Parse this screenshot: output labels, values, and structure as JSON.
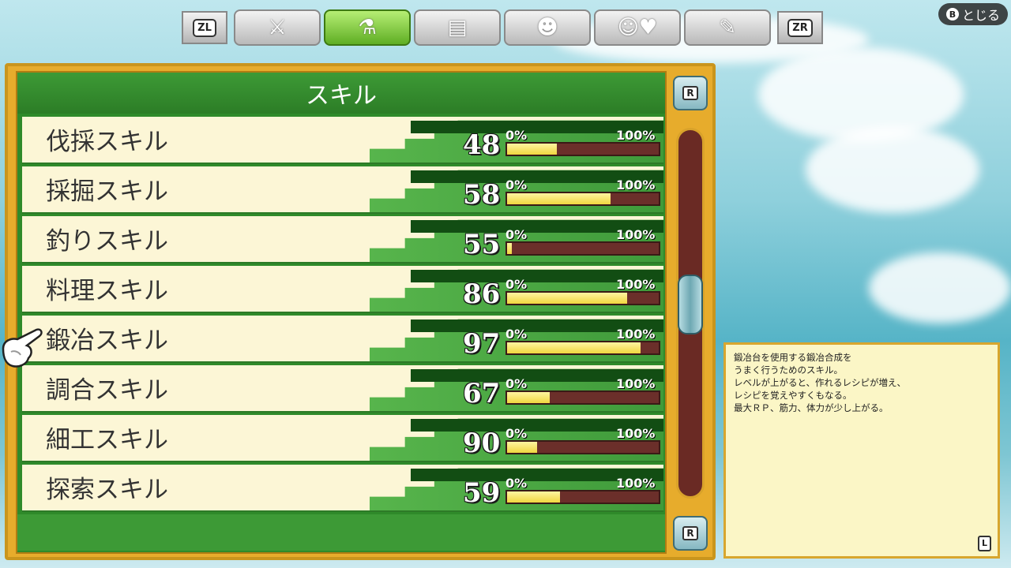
{
  "tabs": {
    "left_shoulder": "ZL",
    "right_shoulder": "ZR",
    "items": [
      {
        "icon": "sword-shield-icon",
        "glyph": "⚔"
      },
      {
        "icon": "potion-hammer-icon",
        "glyph": "⚗"
      },
      {
        "icon": "document-icon",
        "glyph": "▤"
      },
      {
        "icon": "monster-faces-icon",
        "glyph": "☻"
      },
      {
        "icon": "smile-heart-icon",
        "glyph": "☺♥"
      },
      {
        "icon": "wrench-icon",
        "glyph": "✎"
      }
    ],
    "active_index": 1
  },
  "close": {
    "button": "B",
    "label": "とじる"
  },
  "panel": {
    "title": "スキル"
  },
  "skills": [
    {
      "name": "伐採スキル",
      "level": "48",
      "min": "0%",
      "max": "100%",
      "progress": 0.33
    },
    {
      "name": "採掘スキル",
      "level": "58",
      "min": "0%",
      "max": "100%",
      "progress": 0.68
    },
    {
      "name": "釣りスキル",
      "level": "55",
      "min": "0%",
      "max": "100%",
      "progress": 0.03
    },
    {
      "name": "料理スキル",
      "level": "86",
      "min": "0%",
      "max": "100%",
      "progress": 0.79
    },
    {
      "name": "鍛冶スキル",
      "level": "97",
      "min": "0%",
      "max": "100%",
      "progress": 0.88
    },
    {
      "name": "調合スキル",
      "level": "67",
      "min": "0%",
      "max": "100%",
      "progress": 0.28
    },
    {
      "name": "細工スキル",
      "level": "90",
      "min": "0%",
      "max": "100%",
      "progress": 0.2
    },
    {
      "name": "探索スキル",
      "level": "59",
      "min": "0%",
      "max": "100%",
      "progress": 0.35
    }
  ],
  "scroll": {
    "up_key": "R",
    "down_key": "R"
  },
  "description": {
    "lines": [
      "鍛冶台を使用する鍛冶合成を",
      "うまく行うためのスキル。",
      "レベルが上がると、作れるレシピが増え、",
      "レシピを覚えやすくもなる。",
      "最大ＲＰ、筋力、体力が少し上がる。"
    ],
    "key": "L"
  },
  "colors": {
    "panel_green": "#2f8a2a",
    "gold_frame": "#e7ac2c",
    "bar_fill": "#f1d73f",
    "bar_empty": "#6b2f2a"
  }
}
